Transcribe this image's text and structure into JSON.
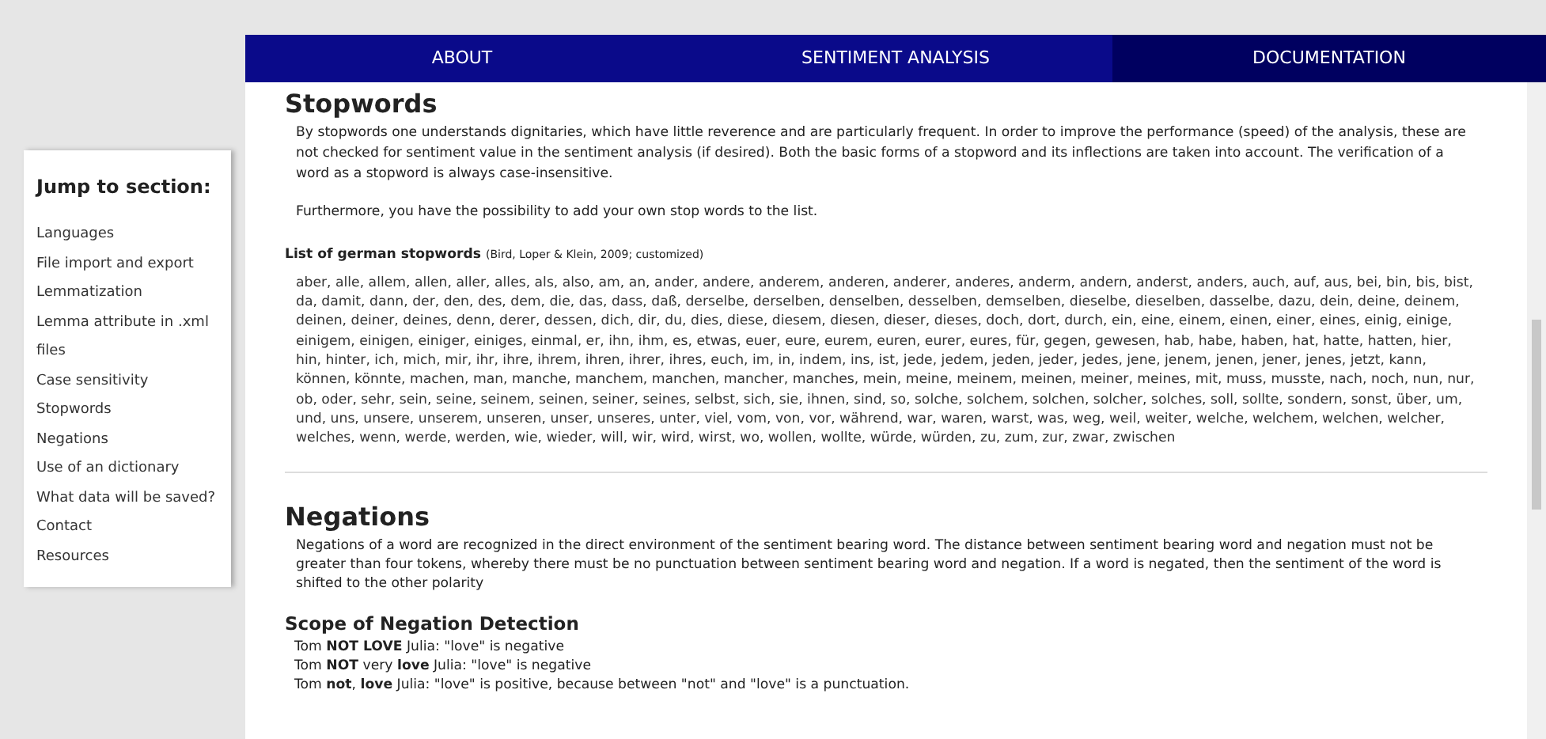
{
  "nav": {
    "tabs": [
      {
        "label": "ABOUT",
        "selected": false
      },
      {
        "label": "SENTIMENT ANALYSIS",
        "selected": false
      },
      {
        "label": "DOCUMENTATION",
        "selected": true
      }
    ]
  },
  "sidebar": {
    "title": "Jump to section:",
    "items": [
      "Languages",
      "File import and export",
      "Lemmatization",
      "Lemma attribute in .xml files",
      "Case sensitivity",
      "Stopwords",
      "Negations",
      "Use of an dictionary",
      "What data will be saved?",
      "Contact",
      "Resources"
    ]
  },
  "stopwords": {
    "heading": "Stopwords",
    "paragraphs": [
      "By stopwords one understands dignitaries, which have little reverence and are particularly frequent. In order to improve the performance (speed) of the analysis, these are not checked for sentiment value in the sentiment analysis (if desired). Both the basic forms of a stopword and its inflections are taken into account. The verification of a word as a stopword is always case-insensitive.",
      "Furthermore, you have the possibility to add your own stop words to the list."
    ],
    "list_title": "List of german stopwords",
    "list_citation": "(Bird, Loper & Klein, 2009; customized)",
    "list": "aber, alle, allem, allen, aller, alles, als, also, am, an, ander, andere, anderem, anderen, anderer, anderes, anderm, andern, anderst, anders, auch, auf, aus, bei, bin, bis, bist, da, damit, dann, der, den, des, dem, die, das, dass, daß, derselbe, derselben, denselben, desselben, demselben, dieselbe, dieselben, dasselbe, dazu, dein, deine, deinem, deinen, deiner, deines, denn, derer, dessen, dich, dir, du, dies, diese, diesem, diesen, dieser, dieses, doch, dort, durch, ein, eine, einem, einen, einer, eines, einig, einige, einigem, einigen, einiger, einiges, einmal, er, ihn, ihm, es, etwas, euer, eure, eurem, euren, eurer, eures, für, gegen, gewesen, hab, habe, haben, hat, hatte, hatten, hier, hin, hinter, ich, mich, mir, ihr, ihre, ihrem, ihren, ihrer, ihres, euch, im, in, indem, ins, ist, jede, jedem, jeden, jeder, jedes, jene, jenem, jenen, jener, jenes, jetzt, kann, können, könnte, machen, man, manche, manchem, manchen, mancher, manches, mein, meine, meinem, meinen, meiner, meines, mit, muss, musste, nach, noch, nun, nur, ob, oder, sehr, sein, seine, seinem, seinen, seiner, seines, selbst, sich, sie, ihnen, sind, so, solche, solchem, solchen, solcher, solches, soll, sollte, sondern, sonst, über, um, und, uns, unsere, unserem, unseren, unser, unseres, unter, viel, vom, von, vor, während, war, waren, warst, was, weg, weil, weiter, welche, welchem, welchen, welcher, welches, wenn, werde, werden, wie, wieder, will, wir, wird, wirst, wo, wollen, wollte, würde, würden, zu, zum, zur, zwar, zwischen"
  },
  "negations": {
    "heading": "Negations",
    "paragraph": "Negations of a word are recognized in the direct environment of the sentiment bearing word. The distance between sentiment bearing word and negation must not be greater than four tokens, whereby there must be no punctuation between sentiment bearing word and negation. If a word is negated, then the sentiment of the word is shifted to the other polarity",
    "subheading": "Scope of Negation Detection",
    "examples": [
      "Tom **NOT LOVE** Julia: \"love\" is negative",
      "Tom **NOT** very **love** Julia: \"love\" is negative",
      "Tom **not**, **love** Julia: \"love\" is positive, because between \"not\" and \"love\" is a punctuation."
    ]
  }
}
